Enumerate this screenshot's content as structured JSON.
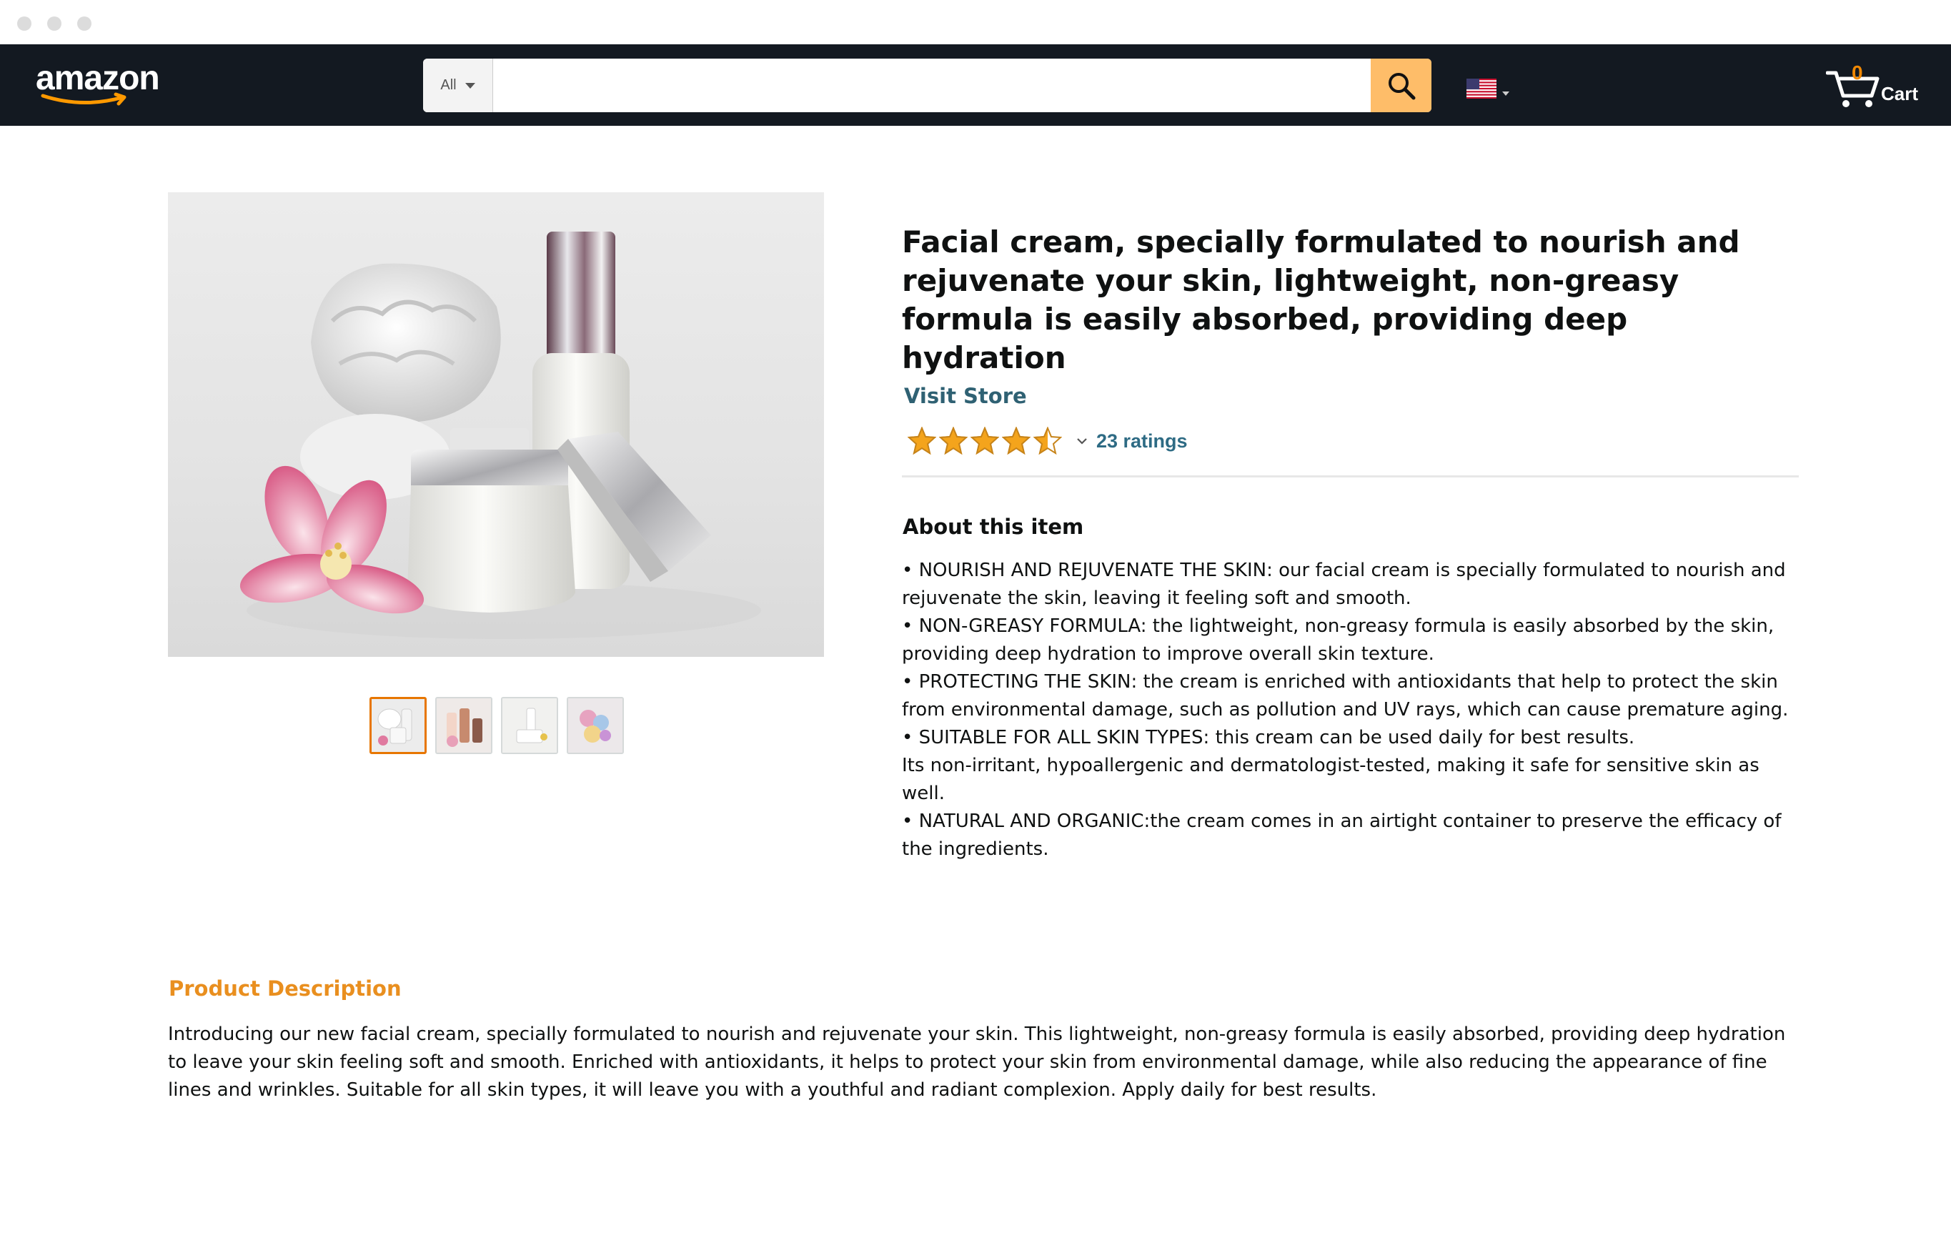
{
  "header": {
    "logo_text": "amazon",
    "search": {
      "category_label": "All",
      "value": "",
      "placeholder": ""
    },
    "cart": {
      "count": "0",
      "label": "Cart"
    },
    "colors": {
      "nav_bg": "#131921",
      "search_button": "#febd69",
      "cart_count": "#f08804"
    },
    "icons": [
      "amazon-smile-logo",
      "search-icon",
      "us-flag-icon",
      "cart-icon"
    ]
  },
  "gallery": {
    "main_image": "facial-cream-product-photo",
    "thumbnails": [
      "thumbnail-1",
      "thumbnail-2",
      "thumbnail-3",
      "thumbnail-4"
    ],
    "active_thumbnail": 0
  },
  "product": {
    "title": "Facial cream, specially formulated to nourish and rejuvenate your skin, lightweight, non-greasy formula is easily absorbed, providing deep hydration",
    "visit_store": "Visit Store",
    "rating_stars": 4.5,
    "ratings_label": "23 ratings",
    "star_color": "#f4a41c"
  },
  "about": {
    "title": "About this item",
    "bullets": [
      "• NOURISH AND REJUVENATE THE SKIN: our facial cream is specially formulated to nourish and rejuvenate the skin, leaving it feeling soft and smooth.",
      "• NON-GREASY FORMULA: the lightweight, non-greasy formula is easily absorbed by the skin, providing deep hydration to improve overall skin texture.",
      "• PROTECTING THE SKIN: the cream is enriched with antioxidants that help to protect the skin from environmental damage, such as pollution and UV rays, which can cause premature aging.",
      "• SUITABLE FOR ALL SKIN TYPES: this cream can be used daily for best results.",
      "Its non-irritant, hypoallergenic and dermatologist-tested, making it safe for sensitive skin as well.",
      "• NATURAL AND ORGANIC:the cream comes in an airtight container to preserve the efficacy of the ingredients."
    ]
  },
  "description": {
    "title": "Product Description",
    "body": "Introducing our new facial cream, specially formulated to nourish and rejuvenate your skin. This lightweight, non-greasy formula is easily absorbed, providing deep hydration to leave your skin feeling soft and smooth. Enriched with antioxidants, it helps to protect your skin from environmental damage, while also reducing the appearance of fine lines and wrinkles. Suitable for all skin types, it will leave you with a youthful and radiant complexion. Apply daily for best results.",
    "title_color": "#e98f1f"
  }
}
